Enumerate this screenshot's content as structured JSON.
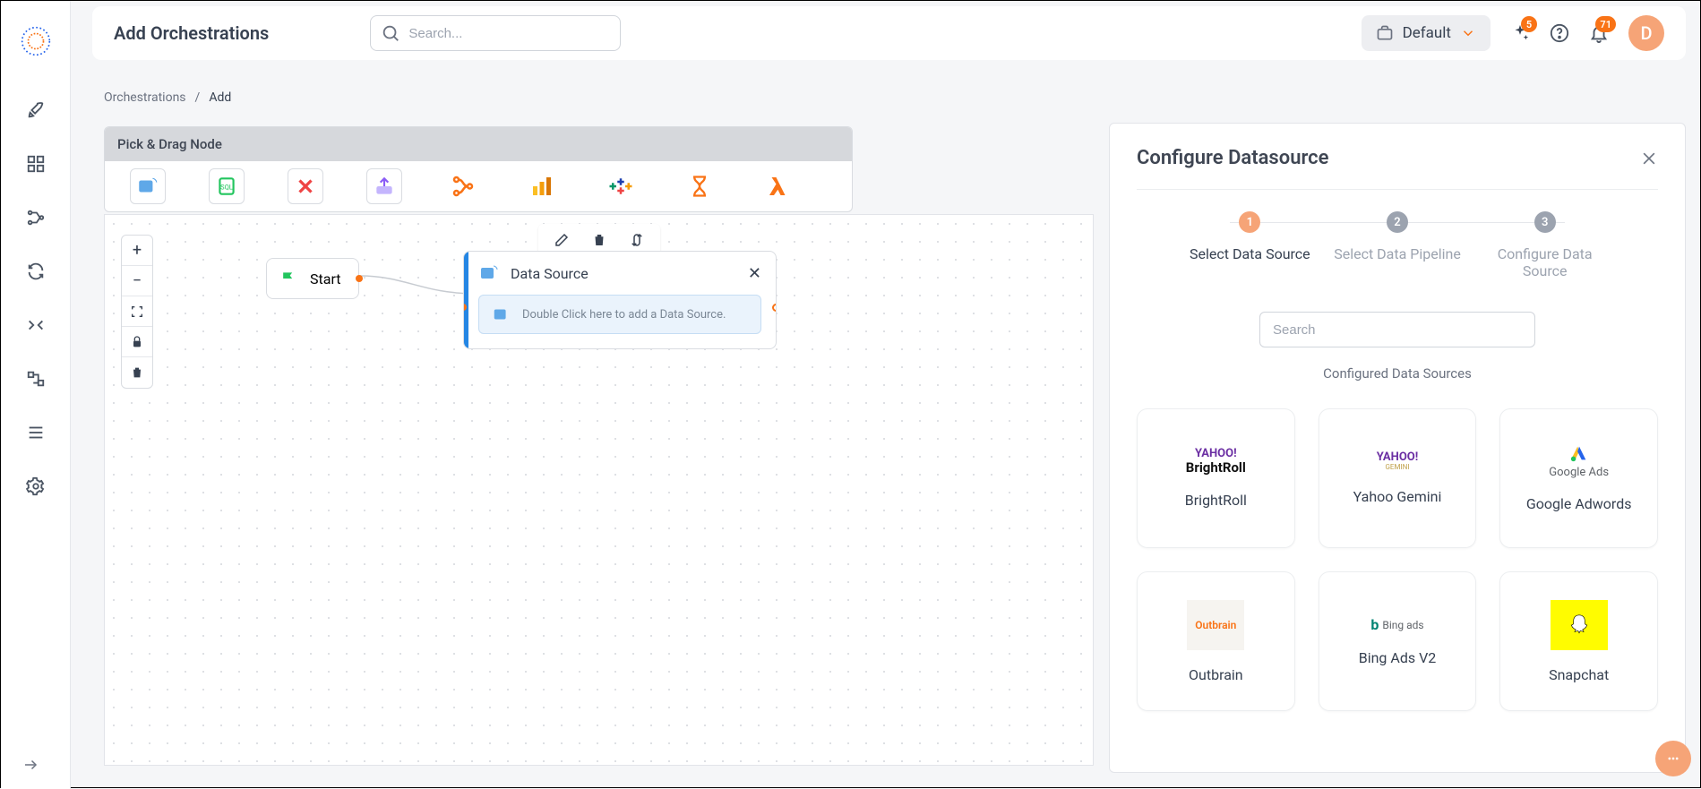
{
  "header": {
    "title": "Add Orchestrations",
    "search_placeholder": "Search...",
    "workspace_label": "Default",
    "sparkle_badge": "5",
    "bell_badge": "71",
    "avatar_letter": "D"
  },
  "breadcrumb": {
    "parent": "Orchestrations",
    "sep": "/",
    "current": "Add"
  },
  "palette": {
    "title": "Pick & Drag Node"
  },
  "canvas": {
    "start_label": "Start",
    "ds_node_title": "Data Source",
    "ds_node_hint": "Double Click here to add a Data Source."
  },
  "panel": {
    "title": "Configure Datasource",
    "steps": {
      "s1": "1",
      "s1_label": "Select Data Source",
      "s2": "2",
      "s2_label": "Select Data Pipeline",
      "s3": "3",
      "s3_label": "Configure Data Source"
    },
    "search_placeholder": "Search",
    "subtitle": "Configured Data Sources",
    "cards": {
      "c1": "BrightRoll",
      "c2": "Yahoo Gemini",
      "c3": "Google Adwords",
      "c4": "Outbrain",
      "c5": "Bing Ads V2",
      "c6": "Snapchat"
    }
  }
}
